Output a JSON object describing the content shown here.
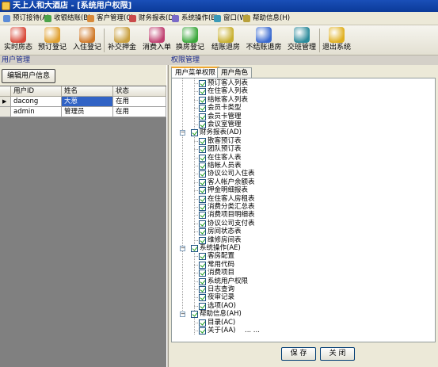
{
  "window": {
    "title": "天上人和大酒店 - [系统用户权限]"
  },
  "menu": [
    {
      "label": "预订接待(A)",
      "color": "#5a8bd8"
    },
    {
      "label": "收银结账(B)",
      "color": "#4aa34a"
    },
    {
      "label": "客户管理(C)",
      "color": "#d88a3a"
    },
    {
      "label": "财务报表(D)",
      "color": "#c94a4a"
    },
    {
      "label": "系统操作(E)",
      "color": "#7a6ac8"
    },
    {
      "label": "窗口(W)",
      "color": "#3a9ab8"
    },
    {
      "label": "帮助信息(H)",
      "color": "#b8a03a"
    }
  ],
  "toolbar": [
    {
      "label": "实时房态",
      "icon": "room-status-icon",
      "color": "#d94a3a"
    },
    {
      "label": "预订登记",
      "icon": "reservation-icon",
      "color": "#e0a030"
    },
    {
      "label": "入住登记",
      "icon": "checkin-icon",
      "color": "#d07a2a"
    },
    {
      "label": "补交押金",
      "icon": "deposit-icon",
      "color": "#c9a040"
    },
    {
      "label": "消费入单",
      "icon": "consume-icon",
      "color": "#c04070"
    },
    {
      "label": "换房登记",
      "icon": "change-room-icon",
      "color": "#3ca83c"
    },
    {
      "label": "结账退房",
      "icon": "checkout-icon",
      "color": "#c8b030"
    },
    {
      "label": "不结账退房",
      "icon": "checkout-no-pay-icon",
      "color": "#3a6ad0"
    },
    {
      "label": "交班管理",
      "icon": "shift-icon",
      "color": "#2a8a9a"
    },
    {
      "label": "退出系统",
      "icon": "exit-icon",
      "color": "#e0b020"
    }
  ],
  "user_panel": {
    "title": "用户管理",
    "edit_button": "编辑用户信息",
    "columns": [
      "用户ID",
      "姓名",
      "状态"
    ],
    "rows": [
      {
        "id": "dacong",
        "name": "大葱",
        "status": "在用"
      },
      {
        "id": "admin",
        "name": "管理员",
        "status": "在用"
      }
    ]
  },
  "perm_panel": {
    "title": "权限管理",
    "tabs": [
      "用户菜单权限",
      "用户角色"
    ],
    "tree": [
      {
        "label": "预订客人列表",
        "level": 2
      },
      {
        "label": "在住客人列表",
        "level": 2
      },
      {
        "label": "结帐客人列表",
        "level": 2
      },
      {
        "label": "会员卡类型",
        "level": 2
      },
      {
        "label": "会员卡管理",
        "level": 2
      },
      {
        "label": "会议室管理",
        "level": 2
      },
      {
        "label": "财务报表(AD)",
        "level": 1
      },
      {
        "label": "散客预订表",
        "level": 2
      },
      {
        "label": "团队预订表",
        "level": 2
      },
      {
        "label": "在住客人表",
        "level": 2
      },
      {
        "label": "结帐人员表",
        "level": 2
      },
      {
        "label": "协议公司入住表",
        "level": 2
      },
      {
        "label": "客人帐户余额表",
        "level": 2
      },
      {
        "label": "押金明细报表",
        "level": 2
      },
      {
        "label": "在住客人房租表",
        "level": 2
      },
      {
        "label": "消费分类汇总表",
        "level": 2
      },
      {
        "label": "消费项目明细表",
        "level": 2
      },
      {
        "label": "协议公司支付表",
        "level": 2
      },
      {
        "label": "房间状态表",
        "level": 2
      },
      {
        "label": "维修房间表",
        "level": 2
      },
      {
        "label": "系统操作(AE)",
        "level": 1
      },
      {
        "label": "客房配置",
        "level": 2
      },
      {
        "label": "常用代码",
        "level": 2
      },
      {
        "label": "消费项目",
        "level": 2
      },
      {
        "label": "系统用户权限",
        "level": 2
      },
      {
        "label": "日志查询",
        "level": 2
      },
      {
        "label": "夜审记录",
        "level": 2
      },
      {
        "label": "选项(AO)",
        "level": 2
      },
      {
        "label": "帮助信息(AH)",
        "level": 1
      },
      {
        "label": "目录(AC)",
        "level": 2
      },
      {
        "label": "关于(AA)",
        "level": 2
      }
    ],
    "ellipsis": "... ...",
    "save_button": "保 存",
    "close_button": "关 闭"
  }
}
